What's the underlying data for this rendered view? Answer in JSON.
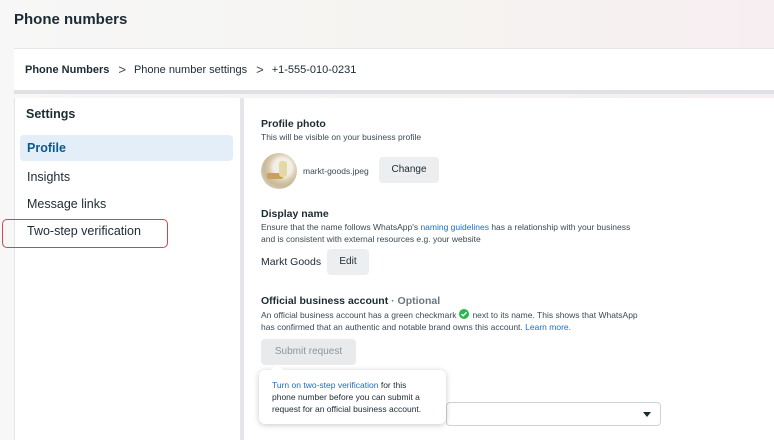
{
  "page": {
    "title": "Phone numbers"
  },
  "breadcrumb": {
    "items": [
      "Phone Numbers",
      "Phone number settings",
      "+1-555-010-0231"
    ],
    "separator": ">"
  },
  "sidebar": {
    "title": "Settings",
    "items": [
      {
        "label": "Profile",
        "active": true
      },
      {
        "label": "Insights",
        "active": false
      },
      {
        "label": "Message links",
        "active": false
      },
      {
        "label": "Two-step verification",
        "active": false
      }
    ]
  },
  "profile_photo": {
    "heading": "Profile photo",
    "description": "This will be visible on your business profile",
    "filename": "markt-goods.jpeg",
    "change_label": "Change"
  },
  "display_name": {
    "heading": "Display name",
    "desc_before": "Ensure that the name follows WhatsApp's ",
    "desc_link": "naming guidelines",
    "desc_after": " has a relationship with your business",
    "desc_line2": "and is consistent with external resources e.g. your website",
    "value": "Markt Goods",
    "edit_label": "Edit"
  },
  "official_account": {
    "heading": "Official business account",
    "optional": " · Optional",
    "desc_before": "An official business account has a green checkmark",
    "desc_after": "next to its name. This shows that WhatsApp",
    "desc_line2": "has confirmed that an authentic and notable brand owns this account.",
    "learn_more": "Learn more.",
    "submit_label": "Submit request"
  },
  "tooltip": {
    "link": "Turn on two-step verification",
    "text_after": " for this",
    "line2": "phone number before you can submit a",
    "line3": "request for an official business account."
  },
  "colors": {
    "accent": "#0a5a8f",
    "link": "#1a6fc7",
    "highlight": "#d1454c",
    "check": "#25b84c"
  }
}
